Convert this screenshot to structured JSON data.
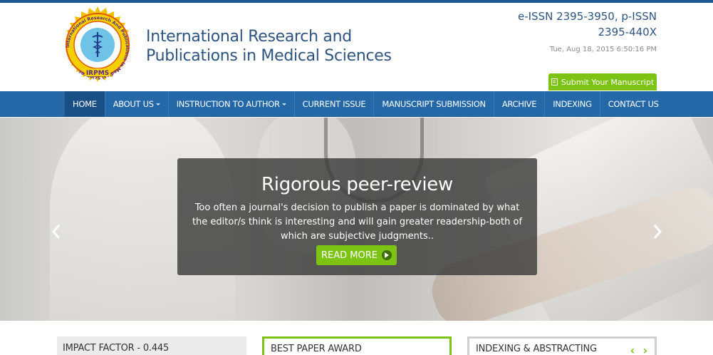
{
  "header": {
    "logo_text": "International Research And Publications In Medical Sciences",
    "logo_acronym": "IRPMS",
    "site_title": "International Research and Publications in Medical Sciences",
    "issn": "e-ISSN 2395-3950, p-ISSN 2395-440X",
    "datetime": "Tue, Aug 18, 2015 6:50:16 PM",
    "submit_label": "Submit Your Manuscript"
  },
  "nav": {
    "items": [
      {
        "label": "HOME",
        "active": true
      },
      {
        "label": "ABOUT US",
        "dropdown": true
      },
      {
        "label": "INSTRUCTION TO AUTHOR",
        "dropdown": true
      },
      {
        "label": "CURRENT ISSUE"
      },
      {
        "label": "MANUSCRIPT SUBMISSION"
      },
      {
        "label": "ARCHIVE"
      },
      {
        "label": "INDEXING"
      },
      {
        "label": "CONTACT US"
      }
    ]
  },
  "hero": {
    "title": "Rigorous peer-review",
    "text": "Too often a journal's decision to publish a paper is dominated by what the editor/s think is interesting and will gain greater readership-both of which are subjective judgments..",
    "button_label": "READ MORE"
  },
  "boxes": {
    "impact": "IMPACT FACTOR - 0.445",
    "award": "BEST PAPER AWARD",
    "indexing": "INDEXING & ABSTRACTING"
  },
  "colors": {
    "primary_blue": "#2468a8",
    "accent_green": "#7dc313",
    "title_blue": "#2d5480"
  }
}
